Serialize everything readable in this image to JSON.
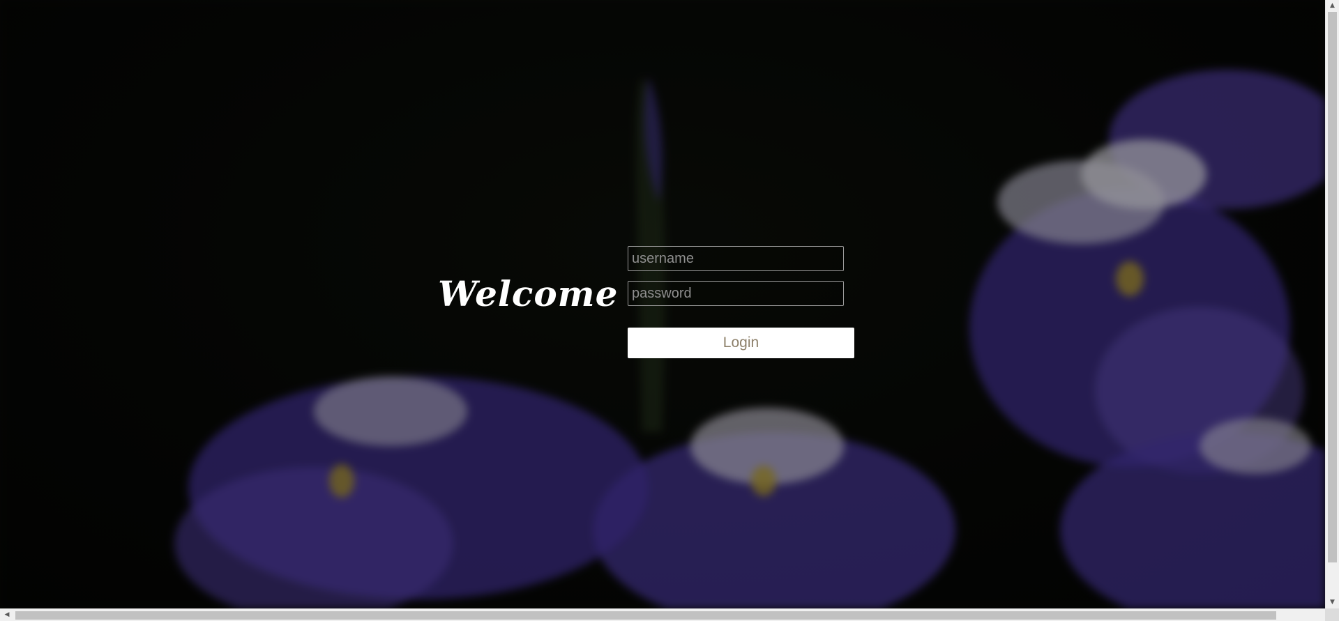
{
  "page": {
    "welcome_text": "Welcome"
  },
  "login_form": {
    "username_placeholder": "username",
    "password_placeholder": "password",
    "login_label": "Login"
  },
  "colors": {
    "background": "#050604",
    "button_background": "#ffffff",
    "button_text": "#8d806a",
    "flower_purple": "#5b3fb8"
  },
  "icons": {
    "scroll_up": "arrow-up-icon",
    "scroll_down": "arrow-down-icon",
    "scroll_left": "arrow-left-icon",
    "scroll_right": "arrow-right-icon"
  }
}
